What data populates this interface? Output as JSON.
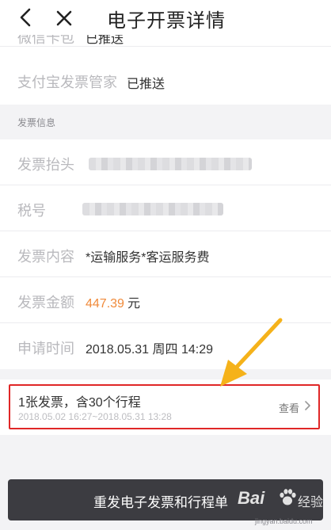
{
  "navbar": {
    "title": "电子开票详情",
    "back_icon": "chevron-left-icon",
    "close_icon": "close-icon"
  },
  "top_clipped_row": {
    "label": "微信卡包",
    "value": "已推送"
  },
  "alipay_row": {
    "label": "支付宝发票管家",
    "value": "已推送"
  },
  "invoice_section": {
    "header": "发票信息",
    "rows": {
      "title": {
        "label": "发票抬头",
        "value_blurred": true
      },
      "tax_id": {
        "label": "税号",
        "value_blurred": true
      },
      "content": {
        "label": "发票内容",
        "value": "*运输服务*客运服务费"
      },
      "amount": {
        "label": "发票金额",
        "value": "447.39",
        "unit": "元"
      },
      "apply_time": {
        "label": "申请时间",
        "value": "2018.05.31 周四 14:29"
      }
    }
  },
  "trip_card": {
    "title": "1张发票，含30个行程",
    "range": "2018.05.02 16:27~2018.05.31 13:28",
    "view_label": "查看",
    "chevron_icon": "chevron-right-icon"
  },
  "footer": {
    "button_label": "重发电子发票和行程单"
  },
  "watermark": {
    "brand": "Bai",
    "brand_cn": "经验",
    "url": "jingyan.baidu.com",
    "icon": "paw-icon"
  },
  "colors": {
    "amount_orange": "#f08a3a",
    "highlight_red": "#e02727",
    "arrow_yellow": "#f5b21a",
    "button_dark": "#3c3c41"
  }
}
